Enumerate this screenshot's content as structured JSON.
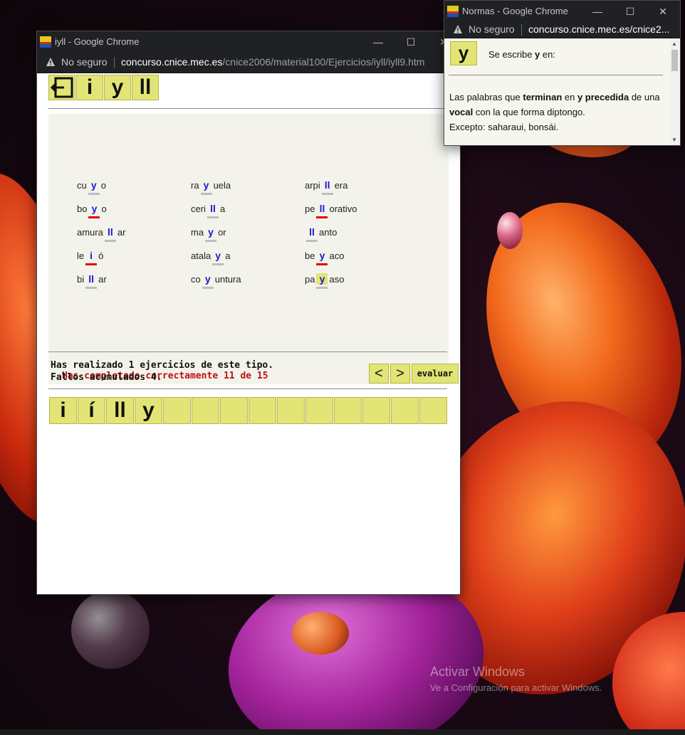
{
  "desktop": {
    "watermark_title": "Activar Windows",
    "watermark_subtitle": "Ve a Configuración para activar Windows."
  },
  "main_window": {
    "title": "iyll - Google Chrome",
    "security_label": "No seguro",
    "url_host": "concurso.cnice.mec.es",
    "url_path": "/cnice2006/material100/Ejercicios/iyll/iyll9.htm",
    "toolbar": [
      "i",
      "y",
      "ll"
    ],
    "exercise": {
      "rows": [
        [
          {
            "pre": "cu",
            "fill": "y",
            "post": "o",
            "state": "ok"
          },
          {
            "pre": "ra",
            "fill": "y",
            "post": "uela",
            "state": "ok"
          },
          {
            "pre": "arpi",
            "fill": "ll",
            "post": "era",
            "state": "ok"
          }
        ],
        [
          {
            "pre": "bo",
            "fill": "y",
            "post": "o",
            "state": "wrong"
          },
          {
            "pre": "ceri",
            "fill": "ll",
            "post": "a",
            "state": "ok"
          },
          {
            "pre": "pe",
            "fill": "ll",
            "post": "orativo",
            "state": "wrong"
          }
        ],
        [
          {
            "pre": "amura",
            "fill": "ll",
            "post": "ar",
            "state": "ok"
          },
          {
            "pre": "ma",
            "fill": "y",
            "post": "or",
            "state": "ok"
          },
          {
            "pre": "",
            "fill": "ll",
            "post": "anto",
            "state": "ok"
          }
        ],
        [
          {
            "pre": "le",
            "fill": "i",
            "post": "ó",
            "state": "wrong"
          },
          {
            "pre": "atala",
            "fill": "y",
            "post": "a",
            "state": "ok"
          },
          {
            "pre": "be",
            "fill": "y",
            "post": "aco",
            "state": "wrong"
          }
        ],
        [
          {
            "pre": "bi",
            "fill": "ll",
            "post": "ar",
            "state": "ok"
          },
          {
            "pre": "co",
            "fill": "y",
            "post": "untura",
            "state": "ok"
          },
          {
            "pre": "pa",
            "fill": "y",
            "post": "aso",
            "state": "selected"
          }
        ]
      ]
    },
    "status_text": "Has completado correctamente 11 de 15",
    "nav": {
      "prev": "<",
      "next": ">",
      "evaluate": "evaluar"
    },
    "stats_line1": "Has realizado 1 ejercicios de este tipo.",
    "stats_line2": "Fallos acumulados 4.",
    "bottom_tiles": [
      "i",
      "í",
      "ll",
      "y",
      "",
      "",
      "",
      "",
      "",
      "",
      "",
      "",
      "",
      ""
    ]
  },
  "popup_window": {
    "title": "Normas - Google Chrome",
    "security_label": "No seguro",
    "url": "concurso.cnice.mec.es/cnice2...",
    "tile": "y",
    "heading_pre": "Se escribe",
    "heading_bold": "y",
    "heading_post": "en:",
    "rule_parts": [
      {
        "t": "Las palabras que ",
        "b": false
      },
      {
        "t": "terminan",
        "b": true
      },
      {
        "t": " en ",
        "b": false
      },
      {
        "t": "y precedida",
        "b": true
      },
      {
        "t": " de una ",
        "b": false
      },
      {
        "t": "vocal",
        "b": true
      },
      {
        "t": " con la que forma diptongo.",
        "b": false
      }
    ],
    "exception": "Excepto: saharaui, bonsái."
  },
  "colors": {
    "tile": "#e2e476",
    "fill_letter": "#1a1ad0",
    "error": "#e00000",
    "status": "#c01010",
    "panel": "#f3f3ec"
  }
}
